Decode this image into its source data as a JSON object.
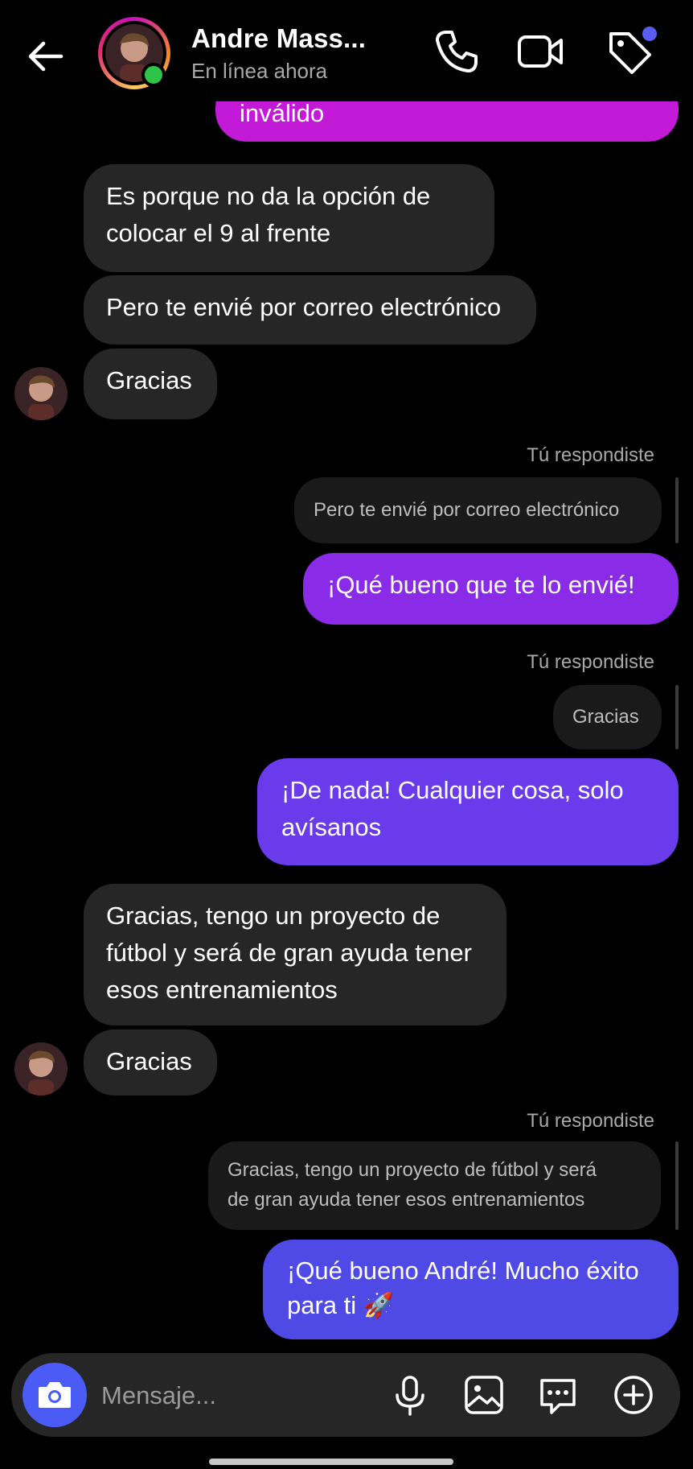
{
  "header": {
    "contact_name": "Andre Mass...",
    "status": "En línea ahora",
    "back_icon": "arrow-left-icon",
    "call_icon": "phone-icon",
    "video_icon": "video-camera-icon",
    "tag_icon": "tag-icon",
    "online_color": "#2ec44a"
  },
  "messages": {
    "m0": "inválido",
    "m1_line1": "Es porque no da la opción de",
    "m1_line2": "colocar el 9 al frente",
    "m2": "Pero te envié por correo electrónico",
    "m3": "Gracias",
    "reply1_label": "Tú respondiste",
    "reply1_quote": "Pero te envié por correo electrónico",
    "m4": "¡Qué bueno que te lo envié!",
    "reply2_label": "Tú respondiste",
    "reply2_quote": "Gracias",
    "m5_line1": "¡De nada! Cualquier cosa, solo",
    "m5_line2": "avísanos",
    "m6_line1": "Gracias, tengo un proyecto de",
    "m6_line2": "fútbol y será de gran ayuda tener",
    "m6_line3": "esos entrenamientos",
    "m7": "Gracias",
    "reply3_label": "Tú respondiste",
    "reply3_quote_line1": "Gracias, tengo un proyecto de fútbol y será",
    "reply3_quote_line2": "de gran ayuda tener esos entrenamientos",
    "m8_line1": "¡Qué bueno André! Mucho éxito",
    "m8_line2": "para ti 🚀"
  },
  "composer": {
    "placeholder": "Mensaje...",
    "camera_icon": "camera-icon",
    "mic_icon": "microphone-icon",
    "gallery_icon": "image-icon",
    "sticker_icon": "chat-bubble-icon",
    "add_icon": "plus-circle-icon"
  },
  "colors": {
    "background": "#000000",
    "incoming_bubble": "#262626",
    "outgoing_magenta": "#c21ad6",
    "outgoing_purple": "#8a2be8",
    "outgoing_violet": "#6a3bea",
    "outgoing_blue": "#4f4ae6",
    "camera_button": "#4a5cf5"
  }
}
